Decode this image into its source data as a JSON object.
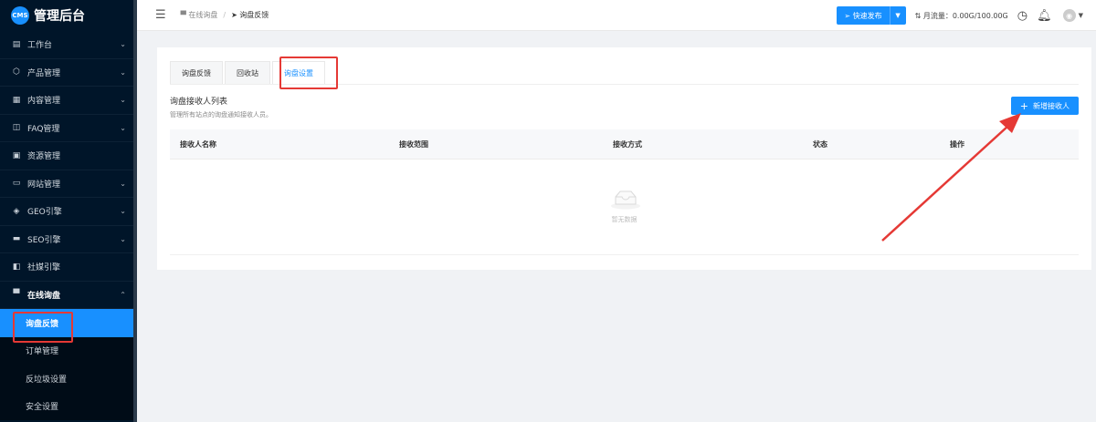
{
  "brand": {
    "logo": "CMS",
    "title": "管理后台"
  },
  "sidebar": {
    "items": [
      {
        "label": "工作台",
        "icon": "dashboard-icon",
        "glyph": "▤",
        "expandable": true
      },
      {
        "label": "产品管理",
        "icon": "box-icon",
        "glyph": "⬡",
        "expandable": true
      },
      {
        "label": "内容管理",
        "icon": "document-icon",
        "glyph": "▦",
        "expandable": true
      },
      {
        "label": "FAQ管理",
        "icon": "faq-icon",
        "glyph": "◫",
        "expandable": true
      },
      {
        "label": "资源管理",
        "icon": "folder-icon",
        "glyph": "▣",
        "expandable": false
      },
      {
        "label": "网站管理",
        "icon": "website-icon",
        "glyph": "▭",
        "expandable": true
      },
      {
        "label": "GEO引擎",
        "icon": "diamond-icon",
        "glyph": "◈",
        "expandable": true
      },
      {
        "label": "SEO引擎",
        "icon": "monitor-icon",
        "glyph": "▬",
        "expandable": true
      },
      {
        "label": "社媒引擎",
        "icon": "share-icon",
        "glyph": "◧",
        "expandable": false
      }
    ],
    "open_group": {
      "label": "在线询盘",
      "icon": "chat-icon",
      "glyph": "▀"
    },
    "sub_items": [
      "询盘反馈",
      "订单管理",
      "反垃圾设置",
      "安全设置"
    ]
  },
  "header": {
    "breadcrumb_home": "在线询盘",
    "breadcrumb_sep": "/",
    "breadcrumb_current": "询盘反馈",
    "publish_label": "快速发布",
    "traffic_label": "月流量：0.00G/100.00G"
  },
  "tabs": [
    "询盘反馈",
    "回收站",
    "询盘设置"
  ],
  "section": {
    "title": "询盘接收人列表",
    "description": "管理所有站点的询盘通知接收人员。",
    "add_button": "新增接收人"
  },
  "table": {
    "columns": [
      "接收人名称",
      "接收范围",
      "接收方式",
      "状态",
      "操作"
    ],
    "empty_text": "暂无数据"
  },
  "colors": {
    "primary": "#1890ff",
    "sidebar": "#001529",
    "annotation": "#e53935"
  }
}
